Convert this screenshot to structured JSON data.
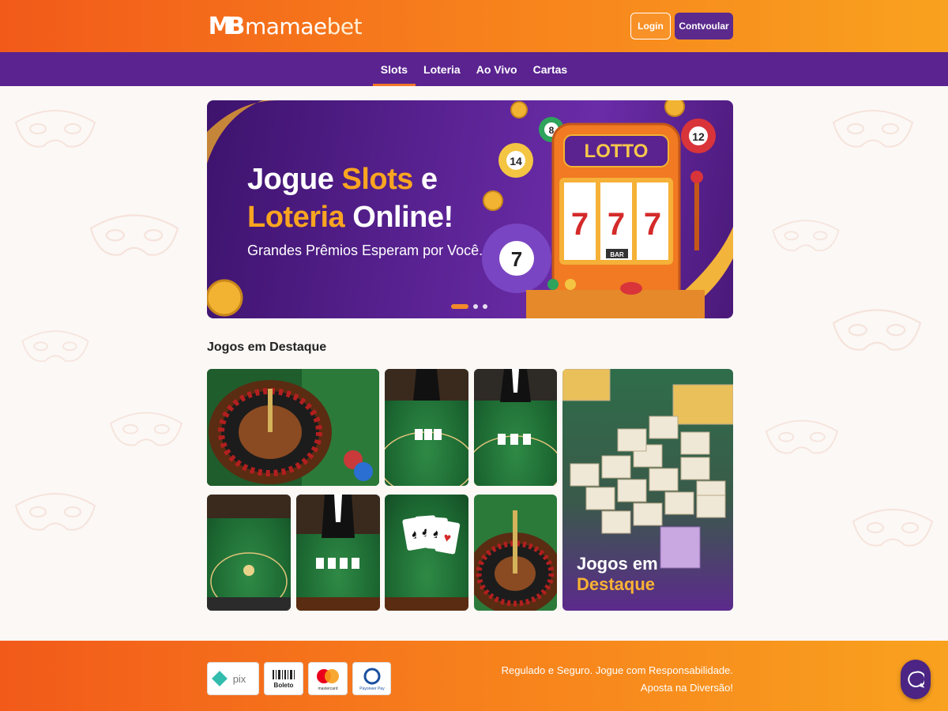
{
  "brand": {
    "logo_mark": "MB",
    "name_part1": "mamae",
    "name_part2": "bet"
  },
  "header": {
    "login_label": "Login",
    "register_label": "Contvoular"
  },
  "nav": {
    "items": [
      {
        "label": "Slots"
      },
      {
        "label": "Loteria"
      },
      {
        "label": "Ao Vivo"
      },
      {
        "label": "Cartas"
      }
    ]
  },
  "hero": {
    "line1_a": "Jogue ",
    "line1_b": "Slots",
    "line1_c": " e",
    "line2_a": "Loteria",
    "line2_b": " Online!",
    "subtitle": "Grandes Prêmios Esperam por Você.",
    "machine_sign": "LOTTO",
    "machine_reels": [
      "7",
      "7",
      "7"
    ],
    "machine_bar": "BAR",
    "balls": [
      "8",
      "14",
      "12",
      "7"
    ],
    "slides": 3,
    "active_slide": 1
  },
  "featured": {
    "title": "Jogos em Destaque",
    "big_tile_a": "Jogos em ",
    "big_tile_b": "Destaque"
  },
  "footer": {
    "payments": [
      "pix",
      "Boleto",
      "mastercard",
      "Payoneer Pay"
    ],
    "text_line1": "Regulado e Seguro. Jogue com Responsabilidade.",
    "text_line2": "Aposta na Diversão!"
  },
  "colors": {
    "orange": "#f7801c",
    "purple": "#5a2390",
    "accent": "#f9a520"
  },
  "icons": [
    "chat-icon",
    "carnival-mask-icon"
  ]
}
